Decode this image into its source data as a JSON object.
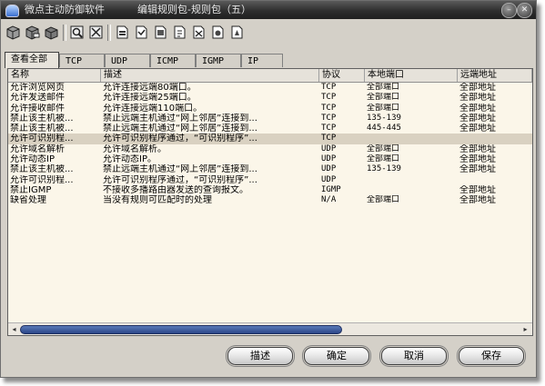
{
  "window": {
    "app_title": "微点主动防御软件",
    "dialog_title": "编辑规则包-规则包（五）",
    "minimize_glyph": "–",
    "close_glyph": "✕"
  },
  "toolbar": {
    "icons": [
      "rule-pack-icon",
      "rule-pack-icon",
      "rule-pack-icon",
      "search-rule-icon",
      "filter-rule-icon",
      "rule-page-icon",
      "rule-page-icon",
      "rule-page-icon",
      "rule-page-icon",
      "rule-page-icon",
      "rule-page-icon",
      "rule-page-icon"
    ]
  },
  "tabs": [
    {
      "label": "查看全部",
      "active": true
    },
    {
      "label": "TCP",
      "active": false
    },
    {
      "label": "UDP",
      "active": false
    },
    {
      "label": "ICMP",
      "active": false
    },
    {
      "label": "IGMP",
      "active": false
    },
    {
      "label": "IP",
      "active": false
    }
  ],
  "table": {
    "columns": [
      "名称",
      "描述",
      "协议",
      "本地端口",
      "远端地址"
    ],
    "rows": [
      {
        "name": "允许浏览网页",
        "desc": "允许连接远端80端口。",
        "protocol": "TCP",
        "local_port": "全部端口",
        "remote": "全部地址",
        "selected": false
      },
      {
        "name": "允许发送邮件",
        "desc": "允许连接远端25端口。",
        "protocol": "TCP",
        "local_port": "全部端口",
        "remote": "全部地址",
        "selected": false
      },
      {
        "name": "允许接收邮件",
        "desc": "允许连接远端110端口。",
        "protocol": "TCP",
        "local_port": "全部端口",
        "remote": "全部地址",
        "selected": false
      },
      {
        "name": "禁止该主机被...",
        "desc": "禁止远端主机通过“网上邻居”连接到...",
        "protocol": "TCP",
        "local_port": "135-139",
        "remote": "全部地址",
        "selected": false
      },
      {
        "name": "禁止该主机被...",
        "desc": "禁止远端主机通过“网上邻居”连接到...",
        "protocol": "TCP",
        "local_port": "445-445",
        "remote": "全部地址",
        "selected": false
      },
      {
        "name": "允许可识别程...",
        "desc": "允许可识别程序通过，“可识别程序”...",
        "protocol": "TCP",
        "local_port": "",
        "remote": "",
        "selected": true
      },
      {
        "name": "允许域名解析",
        "desc": "允许域名解析。",
        "protocol": "UDP",
        "local_port": "全部端口",
        "remote": "全部地址",
        "selected": false
      },
      {
        "name": "允许动态IP",
        "desc": "允许动态IP。",
        "protocol": "UDP",
        "local_port": "全部端口",
        "remote": "全部地址",
        "selected": false
      },
      {
        "name": "禁止该主机被...",
        "desc": "禁止远端主机通过“网上邻居”连接到...",
        "protocol": "UDP",
        "local_port": "135-139",
        "remote": "全部地址",
        "selected": false
      },
      {
        "name": "允许可识别程...",
        "desc": "允许可识别程序通过，“可识别程序”...",
        "protocol": "UDP",
        "local_port": "",
        "remote": "",
        "selected": false
      },
      {
        "name": "禁止IGMP",
        "desc": "不接收多播路由器发送的查询报文。",
        "protocol": "IGMP",
        "local_port": "",
        "remote": "全部地址",
        "selected": false
      },
      {
        "name": "缺省处理",
        "desc": "当没有规则可匹配时的处理",
        "protocol": "N/A",
        "local_port": "全部端口",
        "remote": "全部地址",
        "selected": false
      }
    ]
  },
  "scrollbar": {
    "left_glyph": "◂",
    "right_glyph": "▸"
  },
  "buttons": {
    "describe": "描述",
    "ok": "确定",
    "cancel": "取消",
    "save": "保存"
  }
}
